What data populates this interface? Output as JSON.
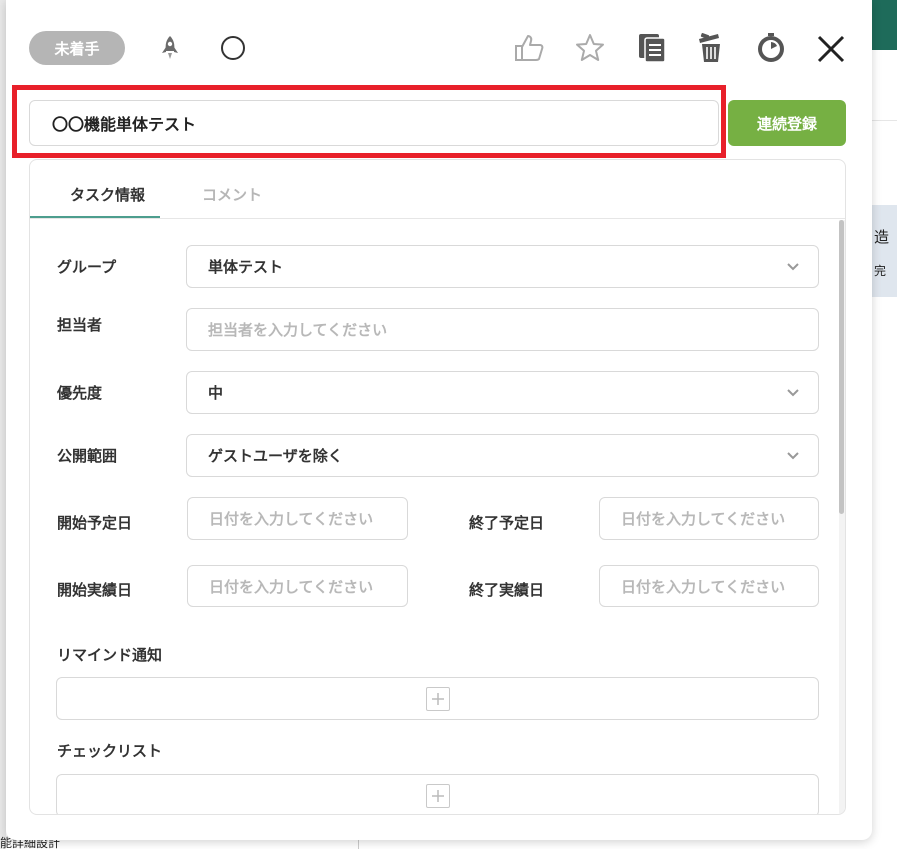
{
  "background": {
    "right_text_1": "造",
    "right_text_2": "完",
    "bottom_text": "能詳細設計"
  },
  "header": {
    "status_badge": "未着手",
    "icons": [
      "rocket-icon",
      "circle-icon",
      "thumbs-up-icon",
      "star-icon",
      "copy-icon",
      "trash-icon",
      "timer-icon",
      "close-icon"
    ]
  },
  "title": {
    "value": "〇〇機能単体テスト",
    "save_button": "連続登録"
  },
  "tabs": {
    "task_info": "タスク情報",
    "comment": "コメント"
  },
  "form": {
    "group": {
      "label": "グループ",
      "value": "単体テスト"
    },
    "assignee": {
      "label": "担当者",
      "placeholder": "担当者を入力してください"
    },
    "priority": {
      "label": "優先度",
      "value": "中"
    },
    "visibility": {
      "label": "公開範囲",
      "value": "ゲストユーザを除く"
    },
    "planned_start": {
      "label": "開始予定日",
      "placeholder": "日付を入力してください"
    },
    "planned_end": {
      "label": "終了予定日",
      "placeholder": "日付を入力してください"
    },
    "actual_start": {
      "label": "開始実績日",
      "placeholder": "日付を入力してください"
    },
    "actual_end": {
      "label": "終了実績日",
      "placeholder": "日付を入力してください"
    },
    "reminder": {
      "label": "リマインド通知"
    },
    "checklist": {
      "label": "チェックリスト"
    }
  },
  "colors": {
    "accent_green": "#76b043",
    "tab_underline": "#4d9e8e",
    "highlight_red": "#e8202a",
    "badge_gray": "#b5b5b5"
  }
}
